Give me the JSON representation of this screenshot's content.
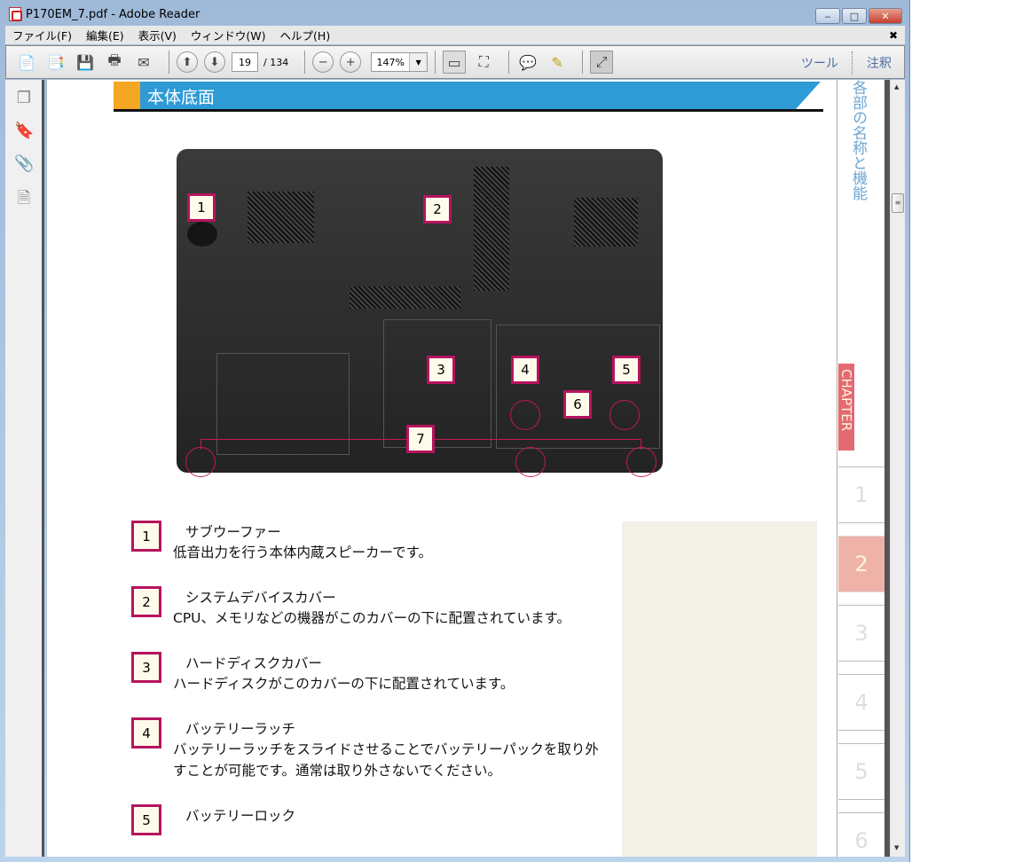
{
  "window": {
    "title": "P170EM_7.pdf - Adobe Reader",
    "minimize": "‒",
    "maximize": "□",
    "close": "✕"
  },
  "menu": [
    "ファイル(F)",
    "編集(E)",
    "表示(V)",
    "ウィンドウ(W)",
    "ヘルプ(H)"
  ],
  "menu_close": "✖",
  "toolbar": {
    "current_page": "19",
    "total_pages": "/ 134",
    "zoom": "147%",
    "tools_label": "ツール",
    "comment_label": "注釈"
  },
  "page": {
    "section_title": "本体底面",
    "side_title": "各部の名称と機能",
    "chapter_label": "CHAPTER",
    "chapter_tabs": [
      "1",
      "2",
      "3",
      "4",
      "5",
      "6"
    ],
    "active_chapter": "2",
    "photo_labels": [
      "1",
      "2",
      "3",
      "4",
      "5",
      "6",
      "7"
    ],
    "items": [
      {
        "num": "1",
        "title": "サブウーファー",
        "desc": "低音出力を行う本体内蔵スピーカーです。"
      },
      {
        "num": "2",
        "title": "システムデバイスカバー",
        "desc": "CPU、メモリなどの機器がこのカバーの下に配置されています。"
      },
      {
        "num": "3",
        "title": "ハードディスクカバー",
        "desc": "ハードディスクがこのカバーの下に配置されています。"
      },
      {
        "num": "4",
        "title": "バッテリーラッチ",
        "desc": "バッテリーラッチをスライドさせることでバッテリーパックを取り外すことが可能です。通常は取り外さないでください。"
      },
      {
        "num": "5",
        "title": "バッテリーロック",
        "desc": ""
      }
    ]
  },
  "colors": {
    "accent_blue": "#2e9bd6",
    "accent_orange": "#f5a623",
    "label_border": "#b6135e",
    "chapter_red": "#e46a72",
    "chapter_active": "#efb2a9"
  }
}
